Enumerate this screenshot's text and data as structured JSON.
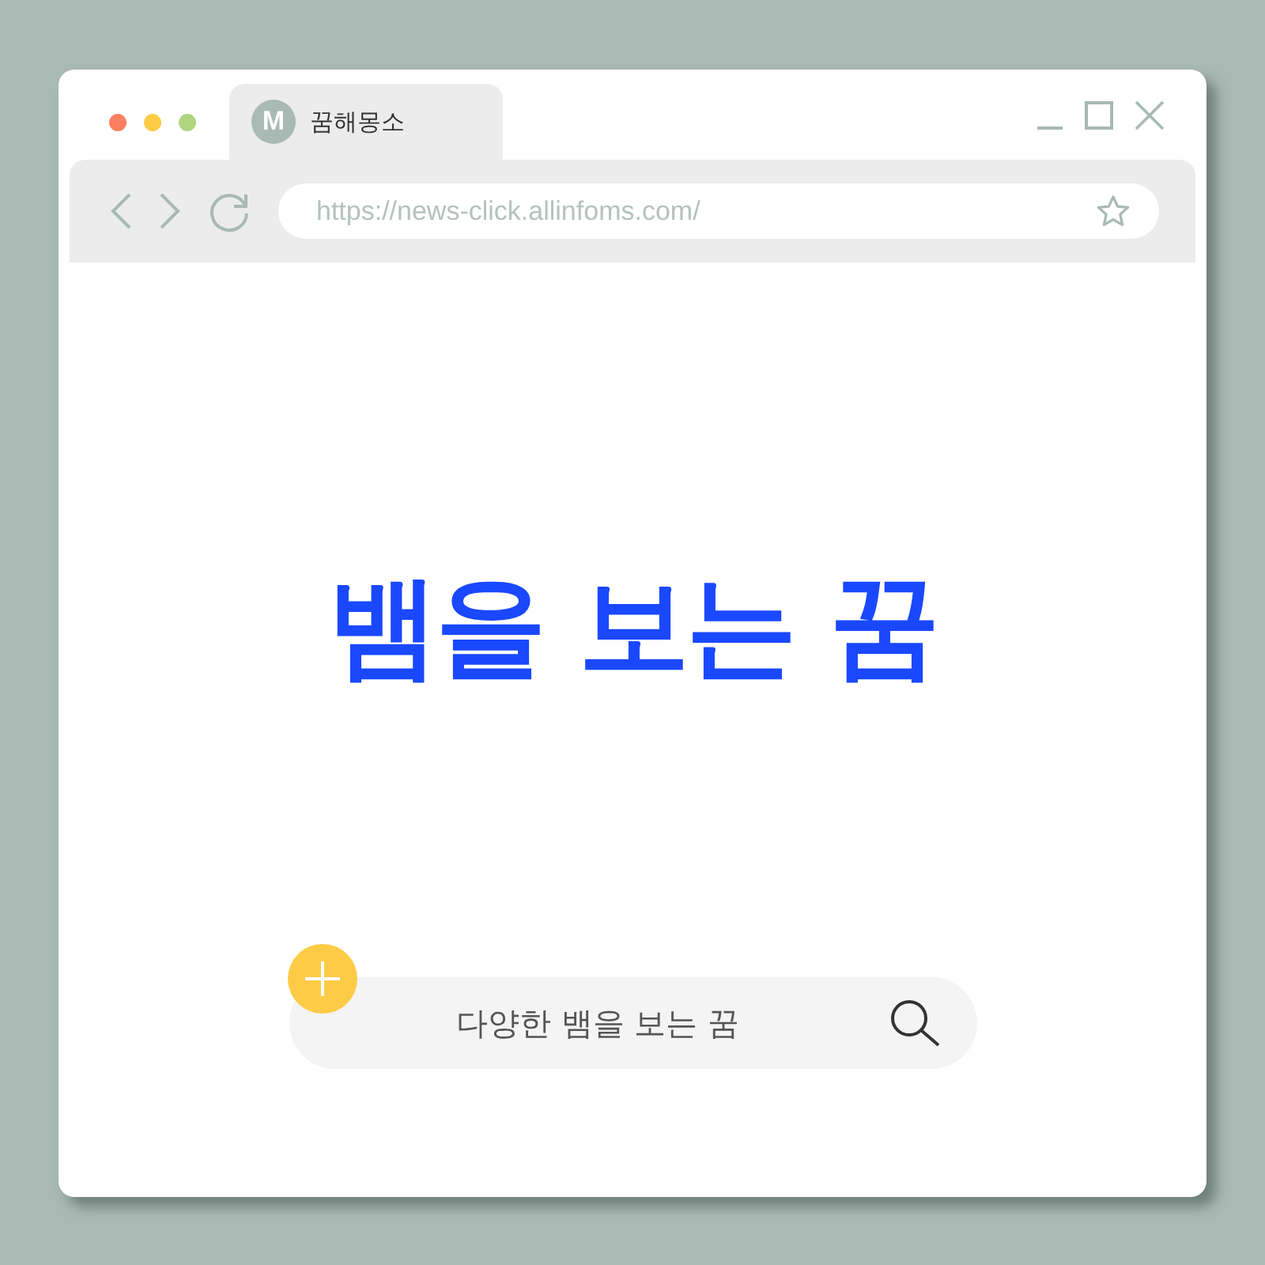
{
  "tabs": [
    {
      "favicon": "M",
      "title": "꿈해몽소",
      "selected": true
    }
  ],
  "address_bar": {
    "url": "https://news-click.allinfoms.com/"
  },
  "heading": "뱀을 보는 꿈",
  "search_bar": {
    "value": "다양한 뱀을 보는 꿈"
  }
}
